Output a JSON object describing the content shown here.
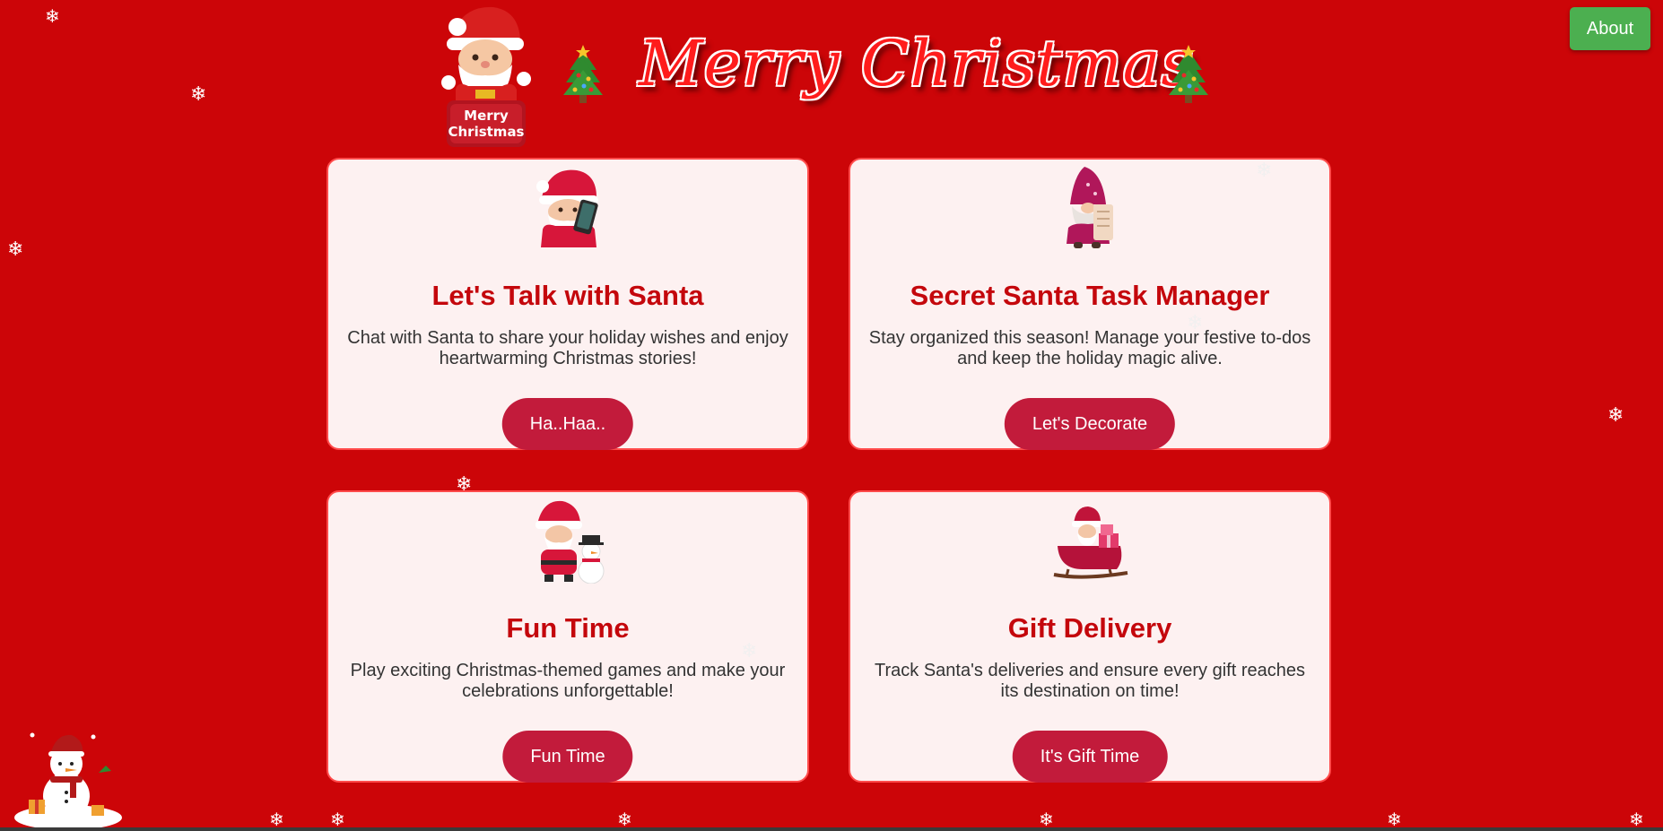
{
  "header": {
    "title": "Merry Christmas",
    "logo_text_line1": "Merry",
    "logo_text_line2": "Christmas",
    "about_label": "About"
  },
  "cards": [
    {
      "title": "Let's Talk with Santa",
      "description": "Chat with Santa to share your holiday wishes and enjoy heartwarming Christmas stories!",
      "button_label": "Ha..Haa..",
      "image_icon": "santa-phone-icon"
    },
    {
      "title": "Secret Santa Task Manager",
      "description": "Stay organized this season! Manage your festive to-dos and keep the holiday magic alive.",
      "button_label": "Let's Decorate",
      "image_icon": "gnome-scroll-icon"
    },
    {
      "title": "Fun Time",
      "description": "Play exciting Christmas-themed games and make your celebrations unforgettable!",
      "button_label": "Fun Time",
      "image_icon": "santa-snowman-icon"
    },
    {
      "title": "Gift Delivery",
      "description": "Track Santa's deliveries and ensure every gift reaches its destination on time!",
      "button_label": "It's Gift Time",
      "image_icon": "santa-sleigh-icon"
    }
  ],
  "decor": {
    "snowflake_glyph": "❄",
    "tree_icon": "christmas-tree-icon",
    "snowman_icon": "snowman-icon"
  },
  "colors": {
    "background": "#cc0508",
    "card_background": "#fdf1f1",
    "card_border": "#ff4b4b",
    "title_red": "#c4070c",
    "button_red": "#c21b3b",
    "about_green": "#4caf50"
  }
}
